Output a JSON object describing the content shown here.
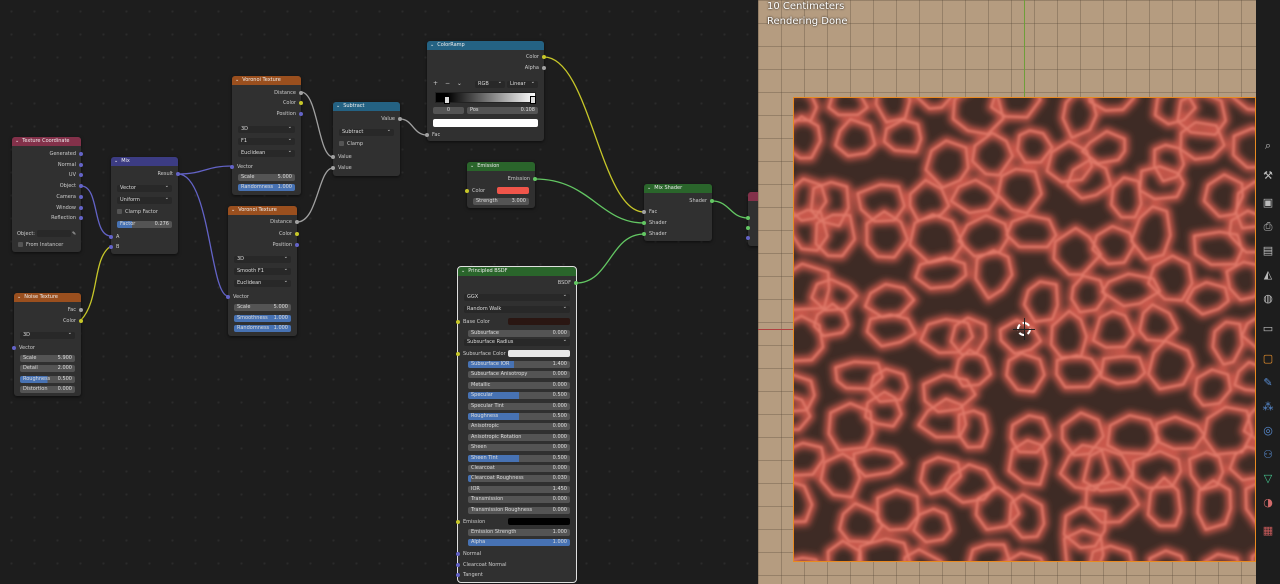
{
  "viewport": {
    "scale_label": "10 Centimeters",
    "status": "Rendering Done"
  },
  "nodes": {
    "texcoord": {
      "title": "Texture Coordinate",
      "outputs": [
        "Generated",
        "Normal",
        "UV",
        "Object",
        "Camera",
        "Window",
        "Reflection"
      ],
      "object_label": "Object:",
      "from_instancer": "From Instancer"
    },
    "noise": {
      "title": "Noise Texture",
      "outputs": [
        "Fac",
        "Color"
      ],
      "dimensions": "3D",
      "vector_label": "Vector",
      "fields": [
        {
          "label": "Scale",
          "value": "5.900"
        },
        {
          "label": "Detail",
          "value": "2.000"
        },
        {
          "label": "Roughness",
          "value": "0.500"
        },
        {
          "label": "Distortion",
          "value": "0.000"
        }
      ]
    },
    "mix": {
      "title": "Mix",
      "output": "Result",
      "data_type": "Vector",
      "mode": "Uniform",
      "clamp": "Clamp Factor",
      "factor_label": "Factor",
      "factor_value": "0.276",
      "in_a": "A",
      "in_b": "B"
    },
    "voronoi1": {
      "title": "Voronoi Texture",
      "outputs": [
        "Distance",
        "Color",
        "Position"
      ],
      "dims": "3D",
      "feature": "F1",
      "metric": "Euclidean",
      "vector_label": "Vector",
      "fields": [
        {
          "label": "Scale",
          "value": "5.000"
        },
        {
          "label": "Randomness",
          "value": "1.000"
        }
      ]
    },
    "voronoi2": {
      "title": "Voronoi Texture",
      "outputs": [
        "Distance",
        "Color",
        "Position"
      ],
      "dims": "3D",
      "feature": "Smooth F1",
      "metric": "Euclidean",
      "vector_label": "Vector",
      "fields": [
        {
          "label": "Scale",
          "value": "5.000"
        },
        {
          "label": "Smoothness",
          "value": "1.000"
        },
        {
          "label": "Randomness",
          "value": "1.000"
        }
      ]
    },
    "subtract": {
      "title": "Subtract",
      "output": "Value",
      "op": "Subtract",
      "clamp": "Clamp",
      "in1": "Value",
      "in2": "Value"
    },
    "colorramp": {
      "title": "ColorRamp",
      "outputs": [
        "Color",
        "Alpha"
      ],
      "plus": "+",
      "minus": "−",
      "chev": "⌄",
      "color_mode": "RGB",
      "interp": "Linear",
      "index": "0",
      "pos_label": "Pos",
      "pos_value": "0.108",
      "fac": "Fac"
    },
    "emission": {
      "title": "Emission",
      "output": "Emission",
      "color_label": "Color",
      "strength_label": "Strength",
      "strength_value": "3.000",
      "color": "#f0554a"
    },
    "mixshader": {
      "title": "Mix Shader",
      "output": "Shader",
      "inputs": [
        "Fac",
        "Shader",
        "Shader"
      ]
    },
    "bsdf": {
      "title": "Principled BSDF",
      "output": "BSDF",
      "distribution": "GGX",
      "subsurface_method": "Random Walk",
      "base_color_label": "Base Color",
      "subsurface_color_label": "Subsurface Color",
      "emission_label": "Emission",
      "subsurface_radius": "Subsurface Radius",
      "fields": [
        {
          "label": "Subsurface",
          "value": "0.000",
          "fill": 0
        },
        {
          "label": "Subsurface IOR",
          "value": "1.400",
          "fill": 0.45
        },
        {
          "label": "Subsurface Anisotropy",
          "value": "0.000",
          "fill": 0
        },
        {
          "label": "Metallic",
          "value": "0.000",
          "fill": 0
        },
        {
          "label": "Specular",
          "value": "0.500",
          "fill": 0.5
        },
        {
          "label": "Specular Tint",
          "value": "0.000",
          "fill": 0
        },
        {
          "label": "Roughness",
          "value": "0.500",
          "fill": 0.5
        },
        {
          "label": "Anisotropic",
          "value": "0.000",
          "fill": 0
        },
        {
          "label": "Anisotropic Rotation",
          "value": "0.000",
          "fill": 0
        },
        {
          "label": "Sheen",
          "value": "0.000",
          "fill": 0
        },
        {
          "label": "Sheen Tint",
          "value": "0.500",
          "fill": 0.5
        },
        {
          "label": "Clearcoat",
          "value": "0.000",
          "fill": 0
        },
        {
          "label": "Clearcoat Roughness",
          "value": "0.030",
          "fill": 0.03
        },
        {
          "label": "IOR",
          "value": "1.450",
          "fill": 0
        },
        {
          "label": "Transmission",
          "value": "0.000",
          "fill": 0
        },
        {
          "label": "Transmission Roughness",
          "value": "0.000",
          "fill": 0
        }
      ],
      "fields2": [
        {
          "label": "Emission Strength",
          "value": "1.000",
          "fill": 0
        },
        {
          "label": "Alpha",
          "value": "1.000",
          "fill": 1
        }
      ],
      "vectors": [
        "Normal",
        "Clearcoat Normal",
        "Tangent"
      ]
    }
  },
  "colors": {
    "accent": "#4772b3",
    "selection": "#e88a20"
  }
}
